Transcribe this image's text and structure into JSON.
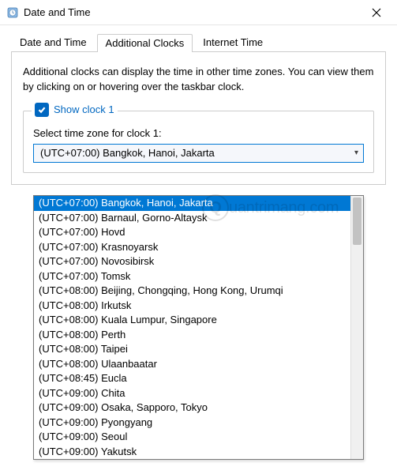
{
  "window": {
    "title": "Date and Time"
  },
  "tabs": {
    "items": [
      {
        "label": "Date and Time"
      },
      {
        "label": "Additional Clocks"
      },
      {
        "label": "Internet Time"
      }
    ],
    "active_index": 1
  },
  "pane": {
    "description": "Additional clocks can display the time in other time zones. You can view them by clicking on or hovering over the taskbar clock."
  },
  "clock1": {
    "checkbox_checked": true,
    "legend_label": "Show clock 1",
    "field_label": "Select time zone for clock 1:",
    "selected_value": "(UTC+07:00) Bangkok, Hanoi, Jakarta"
  },
  "dropdown": {
    "selected_index": 0,
    "options": [
      "(UTC+07:00) Bangkok, Hanoi, Jakarta",
      "(UTC+07:00) Barnaul, Gorno-Altaysk",
      "(UTC+07:00) Hovd",
      "(UTC+07:00) Krasnoyarsk",
      "(UTC+07:00) Novosibirsk",
      "(UTC+07:00) Tomsk",
      "(UTC+08:00) Beijing, Chongqing, Hong Kong, Urumqi",
      "(UTC+08:00) Irkutsk",
      "(UTC+08:00) Kuala Lumpur, Singapore",
      "(UTC+08:00) Perth",
      "(UTC+08:00) Taipei",
      "(UTC+08:00) Ulaanbaatar",
      "(UTC+08:45) Eucla",
      "(UTC+09:00) Chita",
      "(UTC+09:00) Osaka, Sapporo, Tokyo",
      "(UTC+09:00) Pyongyang",
      "(UTC+09:00) Seoul",
      "(UTC+09:00) Yakutsk"
    ]
  },
  "watermark": {
    "text": "uantrimang.com",
    "icon_letter": "Q"
  }
}
